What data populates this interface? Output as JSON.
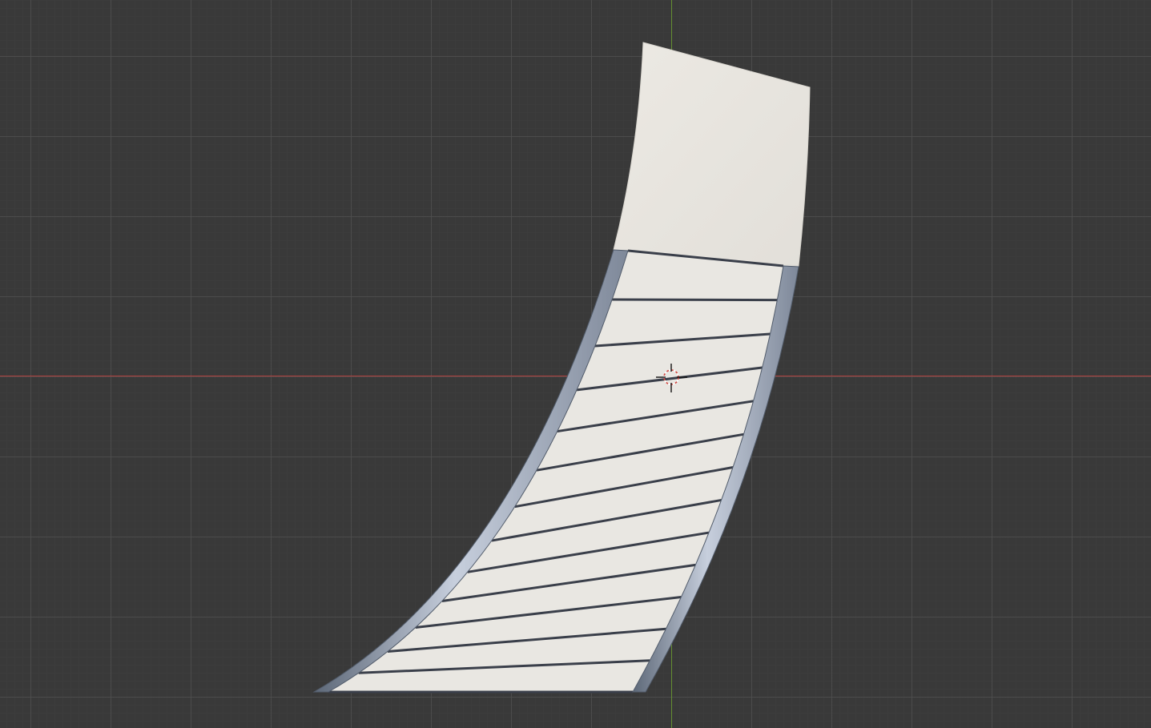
{
  "app": {
    "view": "3D viewport"
  },
  "viewport": {
    "background_color": "#393939",
    "grid_color_major": "#4e4e4e",
    "grid_color_minor": "#3c3c3c",
    "x_axis_color": "#c8423f",
    "y_axis_color": "#6a9b2e"
  },
  "scene": {
    "objects": [
      {
        "name": "curved-walkway",
        "material_color": "#e9e7e2",
        "rail_color": "#9aa4b6",
        "plank_line_color": "#3a3f4a",
        "plank_count": 13
      }
    ],
    "cursor": {
      "kind": "3d-cursor",
      "ring_color": "#d2463f"
    }
  }
}
